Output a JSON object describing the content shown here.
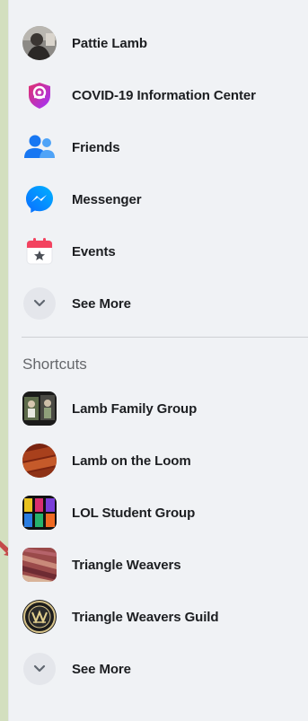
{
  "nav": {
    "items": [
      {
        "label": "Pattie Lamb",
        "icon": "avatar"
      },
      {
        "label": "COVID-19 Information Center",
        "icon": "covid-shield-icon"
      },
      {
        "label": "Friends",
        "icon": "friends-icon"
      },
      {
        "label": "Messenger",
        "icon": "messenger-icon"
      },
      {
        "label": "Events",
        "icon": "calendar-icon"
      }
    ],
    "see_more_label": "See More"
  },
  "shortcuts": {
    "title": "Shortcuts",
    "items": [
      {
        "label": "Lamb Family Group"
      },
      {
        "label": "Lamb on the Loom"
      },
      {
        "label": "LOL Student Group"
      },
      {
        "label": "Triangle Weavers"
      },
      {
        "label": "Triangle Weavers Guild"
      }
    ],
    "see_more_label": "See More"
  },
  "colors": {
    "panel_bg": "#f0f2f5",
    "page_bg": "#d3dfbf",
    "text": "#1c1e21",
    "muted": "#65676b",
    "friends_blue": "#1877f2",
    "covid_purple": "#c32aa3",
    "events_red": "#f3425f",
    "annotation_arrow": "#c44a4a"
  }
}
